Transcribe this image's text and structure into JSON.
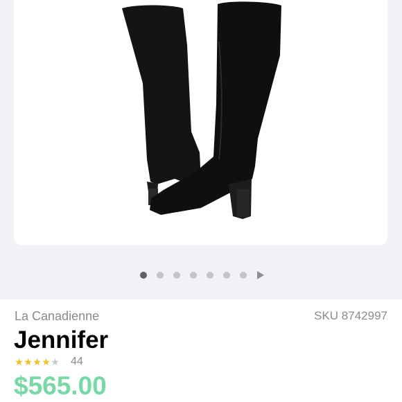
{
  "product": {
    "brand": "La Canadienne",
    "sku": "SKU 8742997",
    "name": "Jennifer",
    "rating": 4,
    "rating_max": 5,
    "review_count": "44",
    "price": "$565.00"
  },
  "gallery": {
    "image_icon": "boots-photo",
    "page_count": 7,
    "active_page": 1
  },
  "colors": {
    "price": "#79d9a6",
    "star_on": "#f2c01d",
    "star_off": "#c8c8cc",
    "muted_text": "#8a8a8e"
  }
}
